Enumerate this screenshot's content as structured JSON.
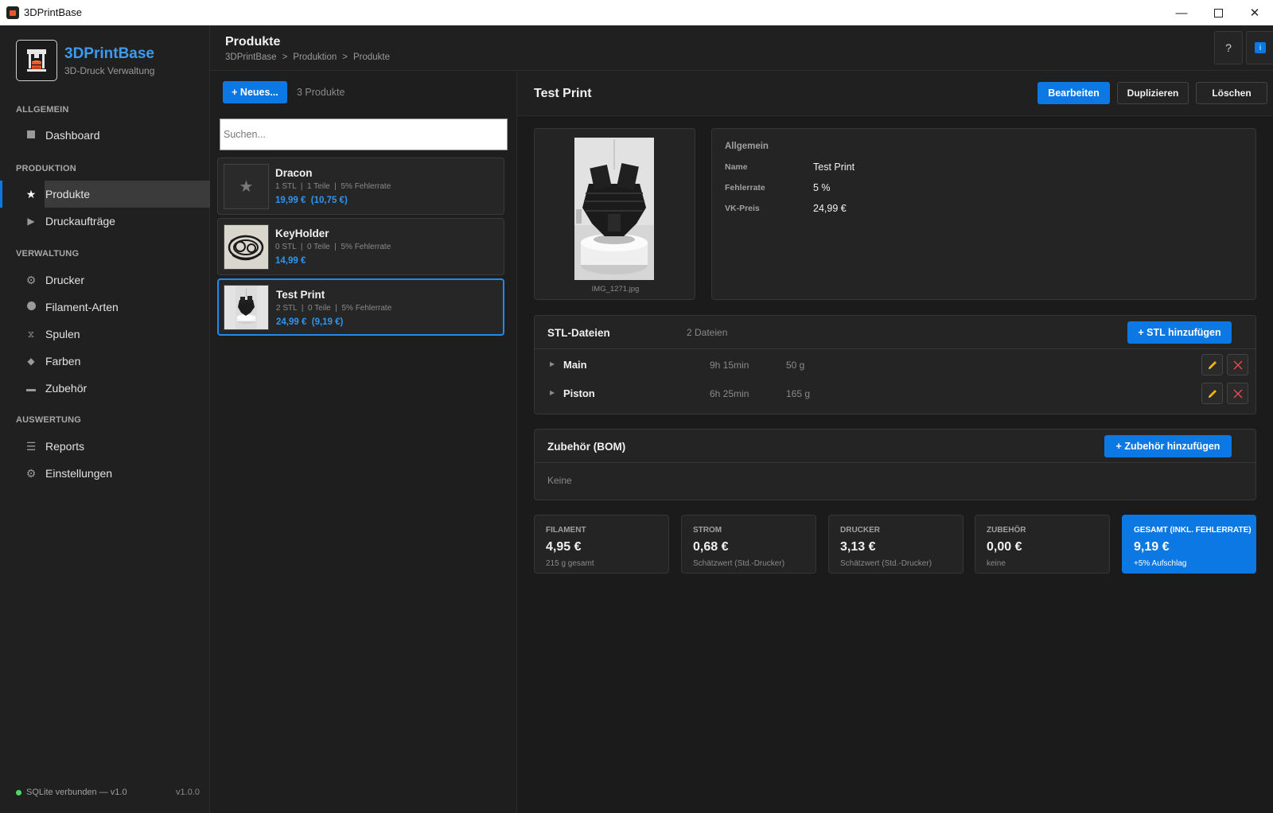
{
  "window": {
    "title": "3DPrintBase"
  },
  "brand": {
    "name": "3DPrintBase",
    "subtitle": "3D-Druck Verwaltung"
  },
  "nav": {
    "sections": [
      {
        "title": "ALLGEMEIN"
      },
      {
        "title": "PRODUKTION"
      },
      {
        "title": "VERWALTUNG"
      },
      {
        "title": "AUSWERTUNG"
      }
    ],
    "items": [
      {
        "label": "Dashboard",
        "icon": "square-icon"
      },
      {
        "label": "Produkte",
        "icon": "star-icon",
        "active": true
      },
      {
        "label": "Druckaufträge",
        "icon": "play-icon"
      },
      {
        "label": "Drucker",
        "icon": "gear-icon"
      },
      {
        "label": "Filament-Arten",
        "icon": "circle-icon"
      },
      {
        "label": "Spulen",
        "icon": "hourglass-icon"
      },
      {
        "label": "Farben",
        "icon": "diamond-icon"
      },
      {
        "label": "Zubehör",
        "icon": "dash-icon"
      },
      {
        "label": "Reports",
        "icon": "list-icon"
      },
      {
        "label": "Einstellungen",
        "icon": "gear-icon"
      }
    ]
  },
  "status": {
    "text": "SQLite verbunden — v1.0",
    "version": "v1.0.0"
  },
  "header": {
    "title": "Produkte",
    "breadcrumb": [
      "3DPrintBase",
      "Produktion",
      "Produkte"
    ],
    "sep": ">",
    "help_label": "?",
    "info_label": "i"
  },
  "list": {
    "new_label": "+ Neues...",
    "count_label": "3 Produkte",
    "search_placeholder": "Suchen...",
    "products": [
      {
        "name": "Dracon",
        "meta": "1 STL  |  1 Teile  |  5% Fehlerrate",
        "price": "19,99 €  (10,75 €)"
      },
      {
        "name": "KeyHolder",
        "meta": "0 STL  |  0 Teile  |  5% Fehlerrate",
        "price": "14,99 €"
      },
      {
        "name": "Test Print",
        "meta": "2 STL  |  0 Teile  |  5% Fehlerrate",
        "price": "24,99 €  (9,19 €)",
        "selected": true
      }
    ]
  },
  "detail": {
    "title": "Test Print",
    "actions": {
      "edit": "Bearbeiten",
      "duplicate": "Duplizieren",
      "delete": "Löschen"
    },
    "image_caption": "IMG_1271.jpg",
    "general": {
      "section": "Allgemein",
      "fields": [
        {
          "key": "Name",
          "value": "Test Print"
        },
        {
          "key": "Fehlerrate",
          "value": "5 %"
        },
        {
          "key": "VK-Preis",
          "value": "24,99 €"
        }
      ]
    },
    "stl": {
      "title": "STL-Dateien",
      "count": "2 Dateien",
      "add_label": "+ STL hinzufügen",
      "files": [
        {
          "name": "Main",
          "time": "9h 15min",
          "weight": "50 g"
        },
        {
          "name": "Piston",
          "time": "6h 25min",
          "weight": "165 g"
        }
      ]
    },
    "bom": {
      "title": "Zubehör (BOM)",
      "add_label": "+ Zubehör hinzufügen",
      "empty": "Keine"
    },
    "costs": [
      {
        "label": "FILAMENT",
        "value": "4,95 €",
        "sub": "215 g gesamt"
      },
      {
        "label": "STROM",
        "value": "0,68 €",
        "sub": "Schätzwert (Std.-Drucker)"
      },
      {
        "label": "DRUCKER",
        "value": "3,13 €",
        "sub": "Schätzwert (Std.-Drucker)"
      },
      {
        "label": "ZUBEHÖR",
        "value": "0,00 €",
        "sub": "keine"
      },
      {
        "label": "GESAMT (INKL. FEHLERRATE)",
        "value": "9,19 €",
        "sub": "+5% Aufschlag"
      }
    ]
  },
  "colors": {
    "accent": "#0b78e3",
    "price": "#2f95f0",
    "status_ok": "#4cd964"
  }
}
